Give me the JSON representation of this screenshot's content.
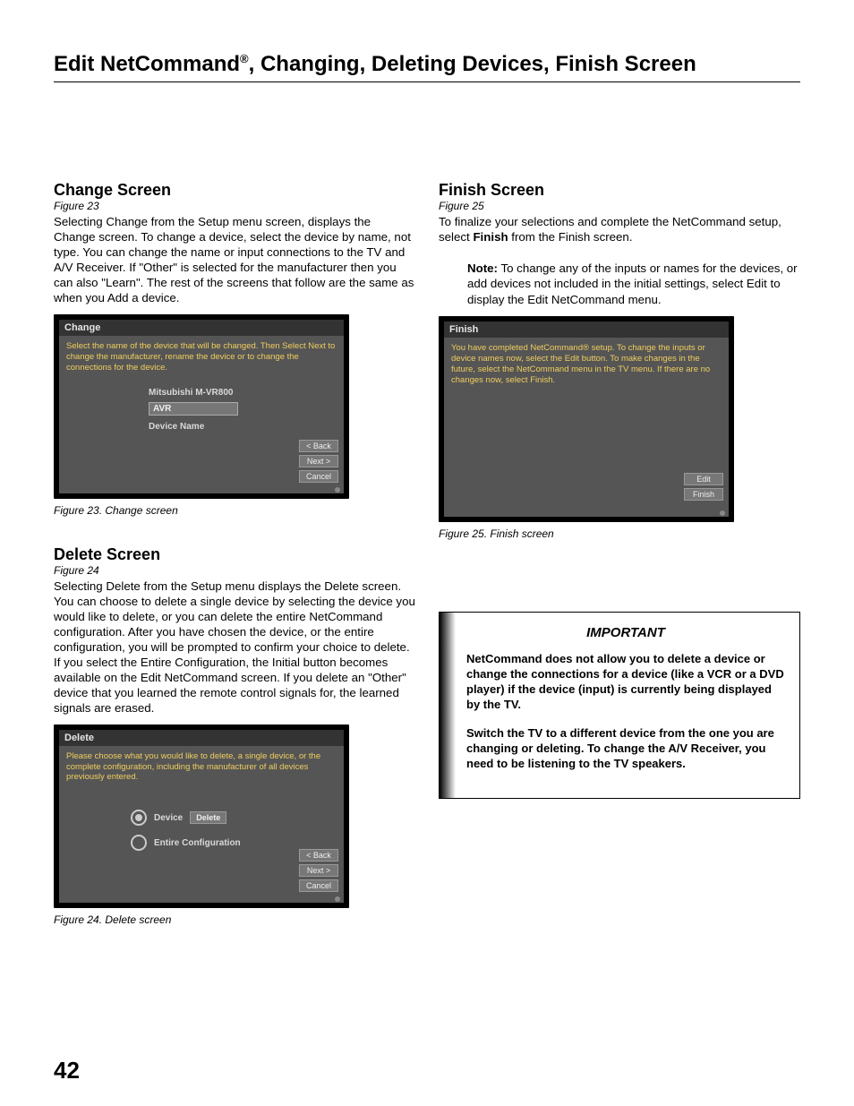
{
  "page": {
    "title_prefix": "Edit NetCommand",
    "title_sup": "®",
    "title_suffix": ", Changing, Deleting  Devices, Finish Screen",
    "number": "42"
  },
  "left": {
    "change": {
      "heading": "Change Screen",
      "figref": "Figure 23",
      "body": "Selecting Change from the Setup menu screen, displays the Change screen. To change a device, select the device by name, not type. You can change the name or input connections to the TV and A/V Receiver. If \"Other\" is selected for the manufacturer then you can also \"Learn\".  The rest of the screens that follow are the same as when you Add a device.",
      "shot": {
        "title": "Change",
        "instr": "Select the name of the device that will be changed.  Then Select Next to change the manufacturer, rename the device or to change the connections for the device.",
        "label_top": "Mitsubishi M-VR800",
        "field": "AVR",
        "label_sub": "Device Name",
        "buttons": {
          "back": "< Back",
          "next": "Next >",
          "cancel": "Cancel"
        }
      },
      "caption": "Figure 23. Change screen"
    },
    "delete": {
      "heading": "Delete Screen",
      "figref": "Figure 24",
      "body": "Selecting Delete from the Setup menu displays the Delete screen.  You can choose to delete a single device by selecting the device you would like to delete, or you can delete the entire NetCommand configuration.  After you have chosen the device, or the entire configuration, you will be prompted to confirm your choice to delete.  If you select the Entire Configuration, the Initial button becomes available on the Edit NetCommand screen.  If you delete an \"Other\" device that you learned the remote control signals for, the learned signals are erased.",
      "shot": {
        "title": "Delete",
        "instr": "Please choose what you would like to delete, a single device, or the complete configuration, including the manufacturer of all devices previously entered.",
        "opt1": "Device",
        "del": "Delete",
        "opt2": "Entire Configuration",
        "buttons": {
          "back": "< Back",
          "next": "Next >",
          "cancel": "Cancel"
        }
      },
      "caption": "Figure 24. Delete screen"
    }
  },
  "right": {
    "finish": {
      "heading": "Finish Screen",
      "figref": "Figure 25",
      "body_pre": "To finalize your selections and complete the NetCommand setup, select ",
      "body_bold": "Finish",
      "body_post": " from the Finish screen.",
      "note_label": "Note:",
      "note_body": "  To change any of the inputs or names for the devices, or add devices not included in the initial settings, select Edit to display the Edit NetCommand menu.",
      "shot": {
        "title": "Finish",
        "instr": "You have completed NetCommand® setup.  To change the inputs or device names now, select the Edit button.  To make changes in the future, select the NetCommand menu in the TV menu.  If there are no changes now, select Finish.",
        "buttons": {
          "edit": "Edit",
          "finish": "Finish"
        }
      },
      "caption": "Figure 25.  Finish screen"
    },
    "important": {
      "title": "IMPORTANT",
      "p1": "NetCommand does not allow you to delete a device or change the connections for a device (like a VCR or a DVD player) if the device (input) is currently being displayed by the TV.",
      "p2": "Switch the TV to a different device from the one you are changing or deleting.  To change the A/V Receiver, you need to be listening to the TV speakers."
    }
  }
}
